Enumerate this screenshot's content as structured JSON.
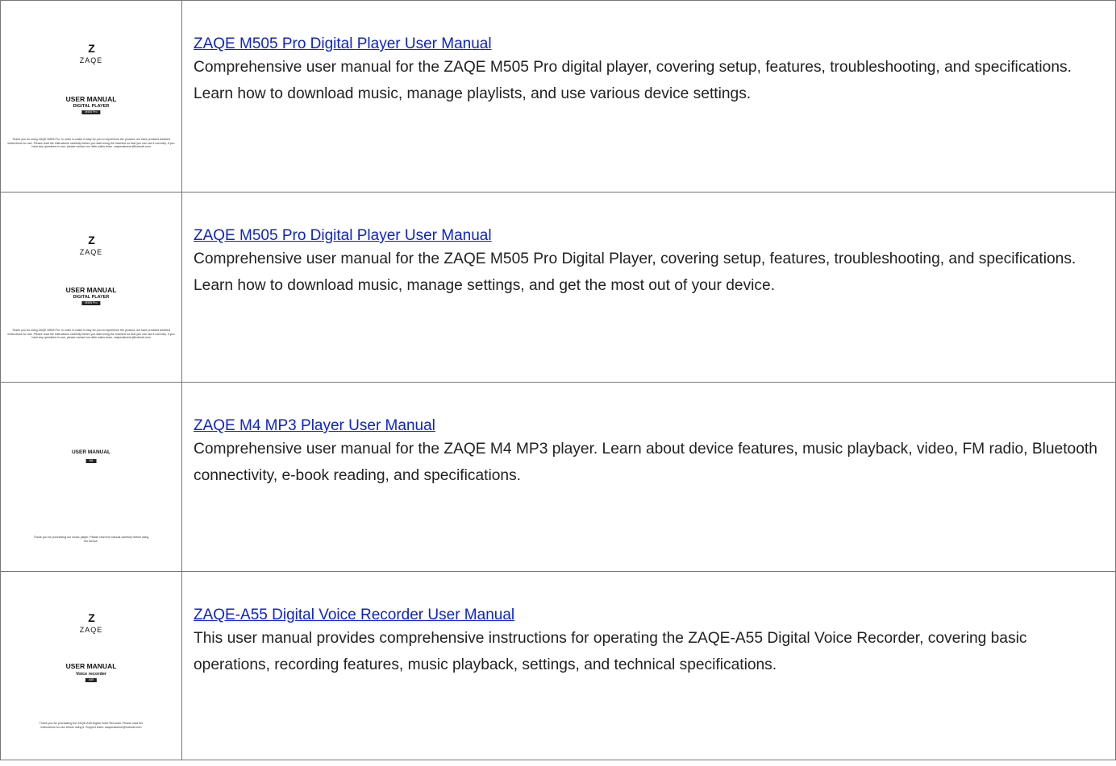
{
  "items": [
    {
      "title": "ZAQE M505 Pro Digital Player User Manual",
      "description": "Comprehensive user manual for the ZAQE M505 Pro digital player, covering setup, features, troubleshooting, and specifications. Learn how to download music, manage playlists, and use various device settings.",
      "thumb": {
        "logo_mark": "Z",
        "logo_text": "ZAQE",
        "title": "USER MANUAL",
        "subtitle": "DIGITAL PLAYER",
        "badge": "M505 Pro",
        "note": "Thank you for using ZAQE M505 Pro. In order to make it easy for you to experience the product, we have provided detailed instructions for use. Please read the instructions carefully before you start using the machine so that you can use it correctly. If you have any questions in use, please contact our after-sales team. zaqecustomer@hotmail.com"
      }
    },
    {
      "title": "ZAQE M505 Pro Digital Player User Manual",
      "description": "Comprehensive user manual for the ZAQE M505 Pro Digital Player, covering setup, features, troubleshooting, and specifications. Learn how to download music, manage settings, and get the most out of your device.",
      "thumb": {
        "logo_mark": "Z",
        "logo_text": "ZAQE",
        "title": "USER MANUAL",
        "subtitle": "DIGITAL PLAYER",
        "badge": "M505 Pro",
        "note": "Thank you for using ZAQE M505 Pro. In order to make it easy for you to experience the product, we have provided detailed instructions for use. Please read the instructions carefully before you start using the machine so that you can use it correctly. If you have any questions in use, please contact our after-sales team. zaqecustomer@hotmail.com"
      }
    },
    {
      "title": "ZAQE M4 MP3 Player User Manual",
      "description": "Comprehensive user manual for the ZAQE M4 MP3 player. Learn about device features, music playback, video, FM radio, Bluetooth connectivity, e-book reading, and specifications.",
      "thumb": {
        "title": "USER MANUAL",
        "badge": "M4",
        "note": "Thank you for purchasing our music player. Please read the manual carefully before using the device."
      }
    },
    {
      "title": "ZAQE-A55 Digital Voice Recorder User Manual",
      "description": "This user manual provides comprehensive instructions for operating the ZAQE-A55 Digital Voice Recorder, covering basic operations, recording features, music playback, settings, and technical specifications.",
      "thumb": {
        "logo_mark": "Z",
        "logo_text": "ZAQE",
        "title": "USER MANUAL",
        "subtitle": "Voice recorder",
        "badge": "A55",
        "note": "Thank you for purchasing the ZAQE-A55 Digital Voice Recorder. Please read the instructions for use before using it. Support team: zaqecustomer@hotmail.com"
      }
    }
  ]
}
